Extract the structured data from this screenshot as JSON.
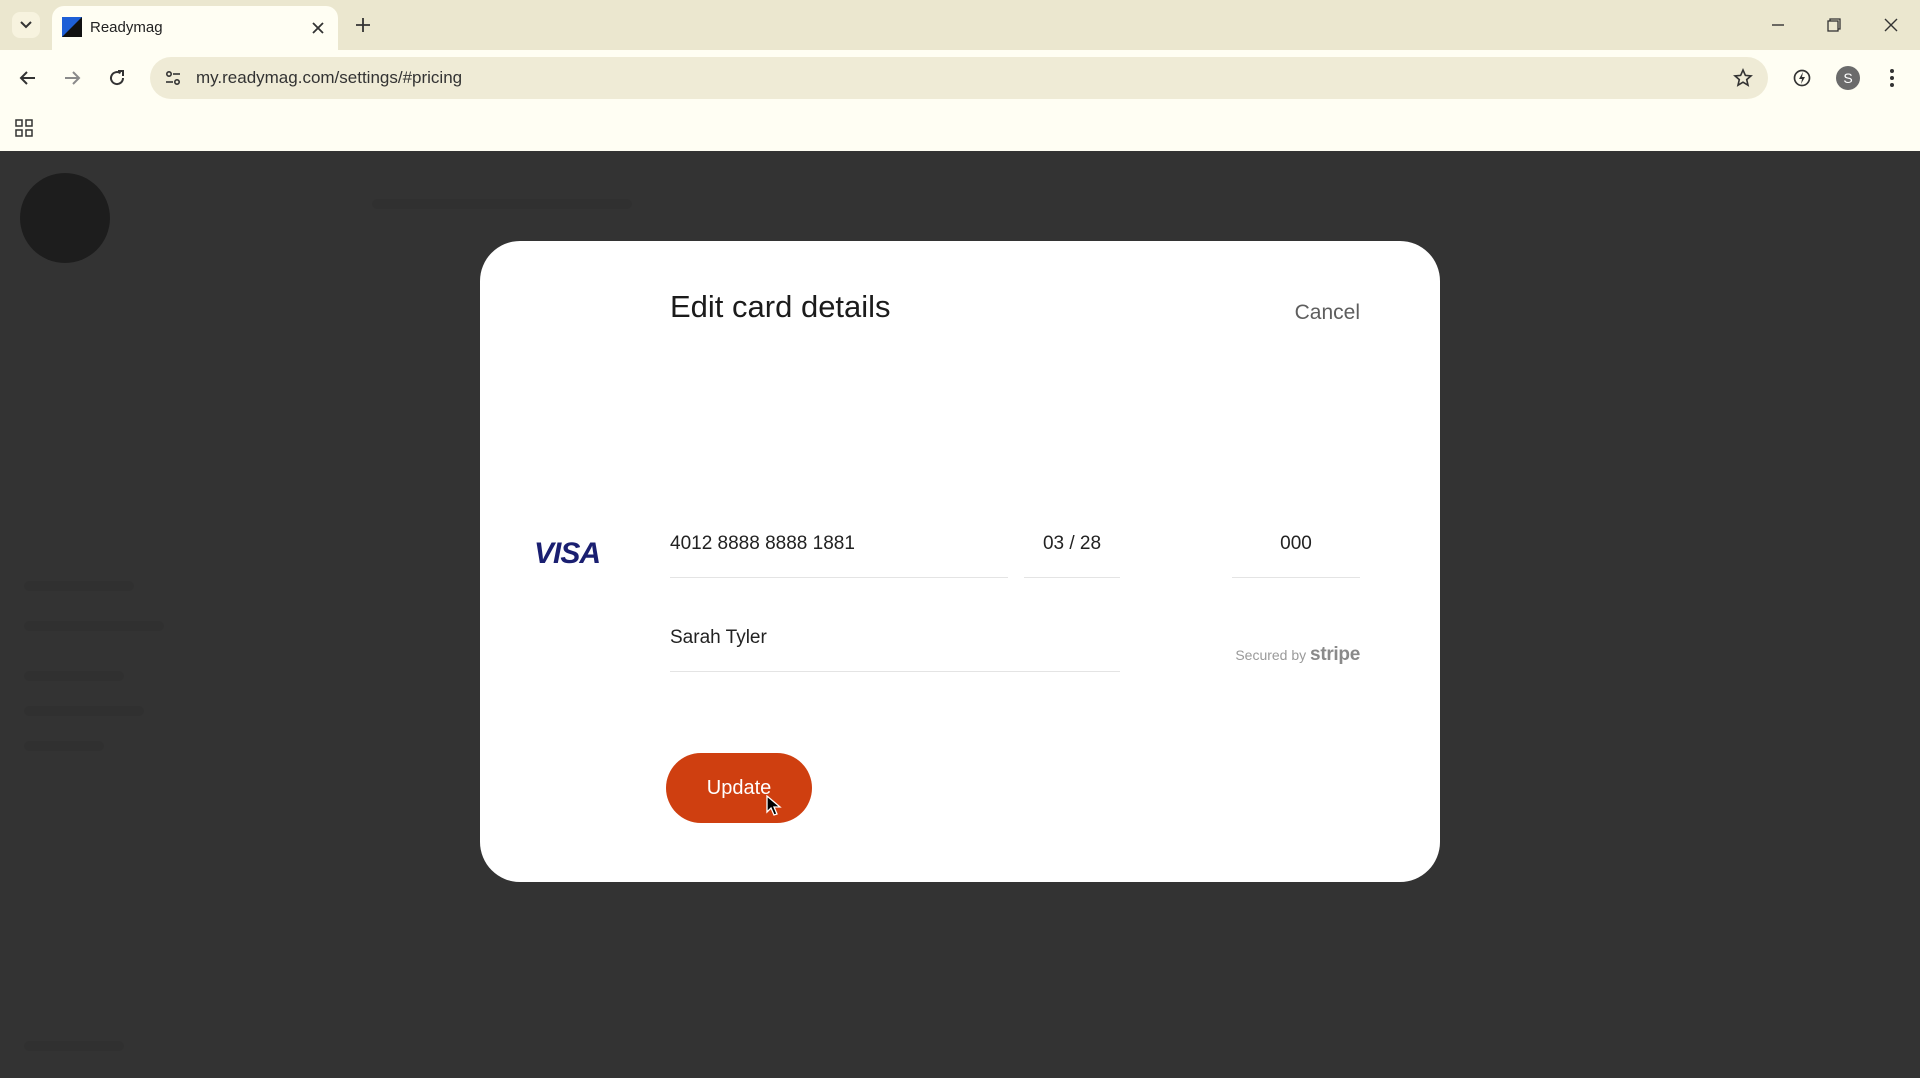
{
  "browser": {
    "tab_title": "Readymag",
    "url": "my.readymag.com/settings/#pricing",
    "profile_initial": "S"
  },
  "modal": {
    "title": "Edit card details",
    "cancel_label": "Cancel",
    "card_brand": "VISA",
    "card_number": "4012 8888 8888 1881",
    "expiry": "03 / 28",
    "cvc": "000",
    "cardholder_name": "Sarah Tyler",
    "secured_prefix": "Secured by",
    "secured_brand": "stripe",
    "update_label": "Update"
  },
  "colors": {
    "accent": "#cf3f10",
    "visa": "#1a1f71",
    "chrome": "#ebe7cf",
    "overlay": "#1e1e1e"
  },
  "icons": [
    "tab-search-icon",
    "readymag-favicon",
    "close-icon",
    "plus-icon",
    "minimize-icon",
    "restore-icon",
    "back-icon",
    "forward-icon",
    "reload-icon",
    "site-info-icon",
    "star-icon",
    "extension-icon",
    "menu-icon",
    "apps-grid-icon",
    "mouse-cursor-icon"
  ]
}
